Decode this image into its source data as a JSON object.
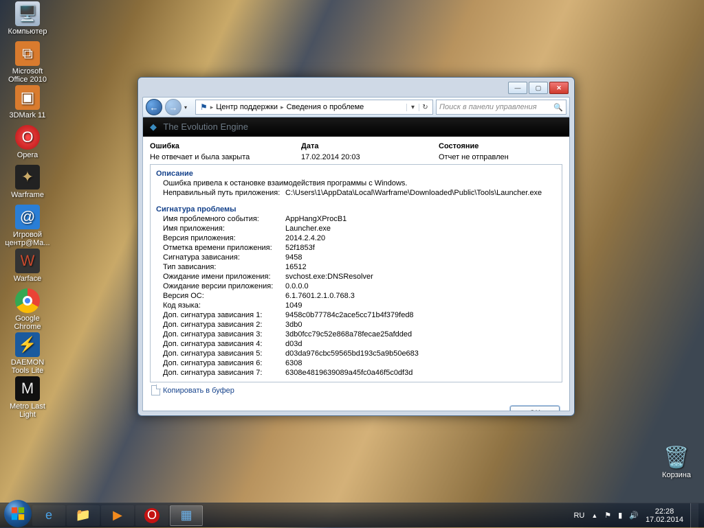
{
  "desktop_icons": {
    "computer": "Компьютер",
    "office": "Microsoft Office 2010",
    "threedmark": "3DMark 11",
    "opera": "Opera",
    "warframe": "Warframe",
    "gamecenter": "Игровой центр@Ma...",
    "warface": "Warface",
    "chrome": "Google Chrome",
    "daemon": "DAEMON Tools Lite",
    "metro": "Metro Last Light",
    "recycle": "Корзина"
  },
  "window": {
    "breadcrumb": {
      "seg1": "Центр поддержки",
      "seg2": "Сведения о проблеме"
    },
    "search_placeholder": "Поиск в панели управления",
    "banner": "The Evolution Engine",
    "summary": {
      "col1_head": "Ошибка",
      "col1_val": "Не отвечает и была закрыта",
      "col2_head": "Дата",
      "col2_val": "17.02.2014 20:03",
      "col3_head": "Состояние",
      "col3_val": "Отчет не отправлен"
    },
    "description": {
      "title": "Описание",
      "line1": "Ошибка привела к остановке взаимодействия программы с Windows.",
      "path_label": "Неправильный путь приложения:",
      "path_val": "C:\\Users\\1\\AppData\\Local\\Warframe\\Downloaded\\Public\\Tools\\Launcher.exe"
    },
    "signature": {
      "title": "Сигнатура проблемы",
      "rows": [
        {
          "k": "Имя проблемного события:",
          "v": "AppHangXProcB1"
        },
        {
          "k": "Имя приложения:",
          "v": "Launcher.exe"
        },
        {
          "k": "Версия приложения:",
          "v": "2014.2.4.20"
        },
        {
          "k": "Отметка времени приложения:",
          "v": "52f1853f"
        },
        {
          "k": "Сигнатура зависания:",
          "v": "9458"
        },
        {
          "k": "Тип зависания:",
          "v": "16512"
        },
        {
          "k": "Ожидание имени приложения:",
          "v": "svchost.exe:DNSResolver"
        },
        {
          "k": "Ожидание версии приложения:",
          "v": "0.0.0.0"
        },
        {
          "k": "Версия ОС:",
          "v": "6.1.7601.2.1.0.768.3"
        },
        {
          "k": "Код языка:",
          "v": "1049"
        },
        {
          "k": "Доп. сигнатура зависания 1:",
          "v": "9458c0b77784c2ace5cc71b4f379fed8"
        },
        {
          "k": "Доп. сигнатура зависания 2:",
          "v": "3db0"
        },
        {
          "k": "Доп. сигнатура зависания 3:",
          "v": "3db0fcc79c52e868a78fecae25afdded"
        },
        {
          "k": "Доп. сигнатура зависания 4:",
          "v": "d03d"
        },
        {
          "k": "Доп. сигнатура зависания 5:",
          "v": "d03da976cbc59565bd193c5a9b50e683"
        },
        {
          "k": "Доп. сигнатура зависания 6:",
          "v": "6308"
        },
        {
          "k": "Доп. сигнатура зависания 7:",
          "v": "6308e4819639089a45fc0a46f5c0df3d"
        }
      ]
    },
    "copy_label": "Копировать в буфер",
    "ok_label": "OK"
  },
  "taskbar": {
    "lang": "RU",
    "time": "22:28",
    "date": "17.02.2014"
  }
}
